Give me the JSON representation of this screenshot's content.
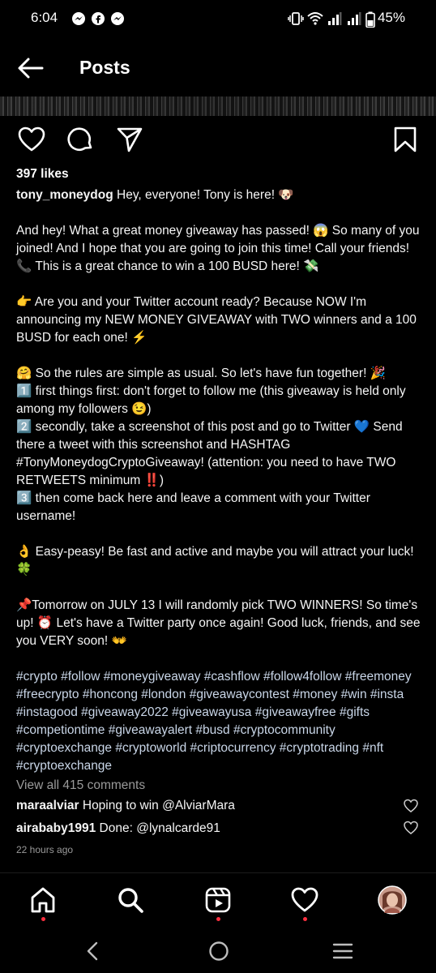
{
  "status_bar": {
    "time": "6:04",
    "battery": "45%"
  },
  "header": {
    "title": "Posts"
  },
  "post": {
    "likes": "397 likes",
    "username": "tony_moneydog",
    "caption_intro": " Hey, everyone! Tony is here! 🐶",
    "caption_body": "\nAnd hey! What a great money giveaway has passed! 😱 So many of you joined! And I hope that you are going to join this time! Call your friends! 📞 This is a great chance to win a 100 BUSD here! 💸\n\n👉 Are you and your Twitter account ready? Because NOW I'm announcing my NEW MONEY GIVEAWAY with TWO winners and a 100 BUSD for each one! ⚡\n\n🤗 So the rules are simple as usual. So let's have fun together! 🎉\n1️⃣ first things first: don't forget to follow me (this giveaway is held only among my followers 😉)\n2️⃣ secondly, take a screenshot of this post and go to Twitter 💙 Send there a tweet with this screenshot and HASHTAG #TonyMoneydogCryptoGiveaway! (attention: you need to have TWO RETWEETS minimum ‼️)\n3️⃣ then come back here and leave a comment with your Twitter username!\n\n👌 Easy-peasy! Be fast and active and maybe you will attract your luck! 🍀\n\n📌Tomorrow on JULY 13 I will randomly pick TWO WINNERS! So time's up! ⏰ Let's have a Twitter party once again! Good luck, friends, and see you VERY soon! 👐\n",
    "hashtags": "#crypto #follow #moneygiveaway #cashflow #follow4follow #freemoney #freecrypto #honcong #london #giveawaycontest #money #win #insta #instagood #giveaway2022 #giveawayusa #giveawayfree #gifts #competiontime #giveawayalert #busd #cryptocommunity #cryptoexchange #cryptoworld #criptocurrency #cryptotrading #nft #cryptoexchange",
    "view_all_comments": "View all 415 comments",
    "comments": [
      {
        "user": "maraalviar",
        "text": " Hoping to win @AlviarMara"
      },
      {
        "user": "airababy1991",
        "text": " Done: @lynalcarde91"
      }
    ],
    "time_ago": "22 hours ago"
  },
  "icons": {
    "back": "arrow-left-icon",
    "like": "heart-icon",
    "comment": "comment-bubble-icon",
    "share": "send-paper-plane-icon",
    "save": "bookmark-icon",
    "nav": [
      "home-icon",
      "search-icon",
      "reels-icon",
      "activity-heart-icon",
      "profile-avatar"
    ]
  },
  "colors": {
    "background": "#000000",
    "text": "#f5f5f5",
    "muted": "#9a9a9a",
    "notification_dot": "#ff3040"
  }
}
